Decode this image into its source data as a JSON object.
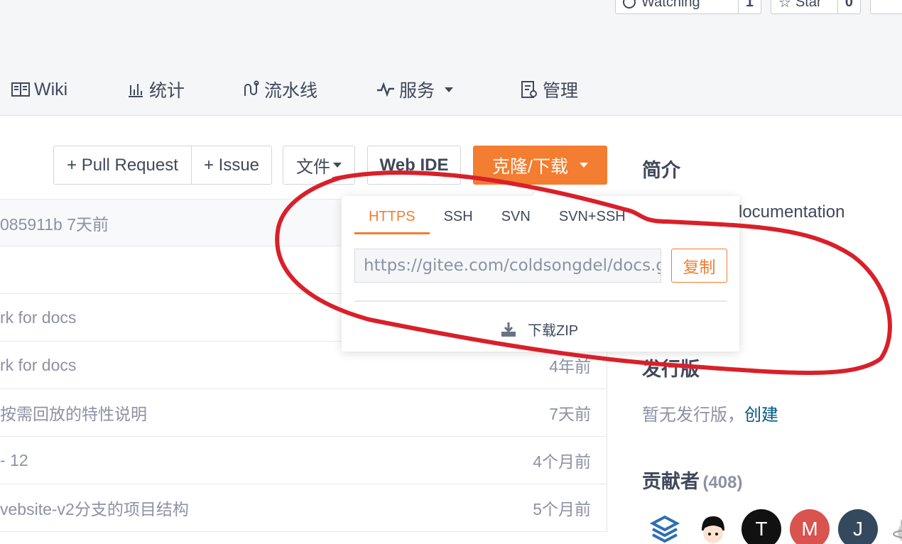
{
  "top_buttons": {
    "watching_label": "Watching",
    "watching_count": "1",
    "star_label": "Star",
    "star_count": "0"
  },
  "nav": {
    "wiki": "Wiki",
    "stats": "统计",
    "pipeline": "流水线",
    "services": "服务",
    "manage": "管理"
  },
  "actions": {
    "pull_request": "+ Pull Request",
    "issue": "+ Issue",
    "file": "文件",
    "web_ide": "Web IDE",
    "clone": "克隆/下载"
  },
  "files": [
    {
      "msg": "085911b   7天前",
      "time": ""
    },
    {
      "msg": "",
      "time": ""
    },
    {
      "msg": "rk for docs",
      "time": ""
    },
    {
      "msg": "rk for docs",
      "time": "4年前"
    },
    {
      "msg": "按需回放的特性说明",
      "time": "7天前"
    },
    {
      "msg": "- 12",
      "time": "4个月前"
    },
    {
      "msg": "vebsite-v2分支的项目结构",
      "time": "5个月前"
    }
  ],
  "sidebar": {
    "intro_title": "简介",
    "intro_text": "locumentation",
    "release_title": "发行版",
    "no_release": "暂无发行版，",
    "create": "创建",
    "contributors_title": "贡献者",
    "contributors_count": "(408)",
    "avatars": [
      {
        "letter": "",
        "color": "#2f6fb3"
      },
      {
        "letter": "",
        "color": "#f2f2f2"
      },
      {
        "letter": "T",
        "color": "#111111"
      },
      {
        "letter": "M",
        "color": "#d9534f"
      },
      {
        "letter": "J",
        "color": "#34495e"
      }
    ]
  },
  "popover": {
    "tabs": [
      "HTTPS",
      "SSH",
      "SVN",
      "SVN+SSH"
    ],
    "url": "https://gitee.com/coldsongdel/docs.git",
    "copy": "复制",
    "download_zip": "下载ZIP"
  },
  "colors": {
    "accent": "#f37d30",
    "annotation": "#d9202a",
    "link": "#005980"
  }
}
